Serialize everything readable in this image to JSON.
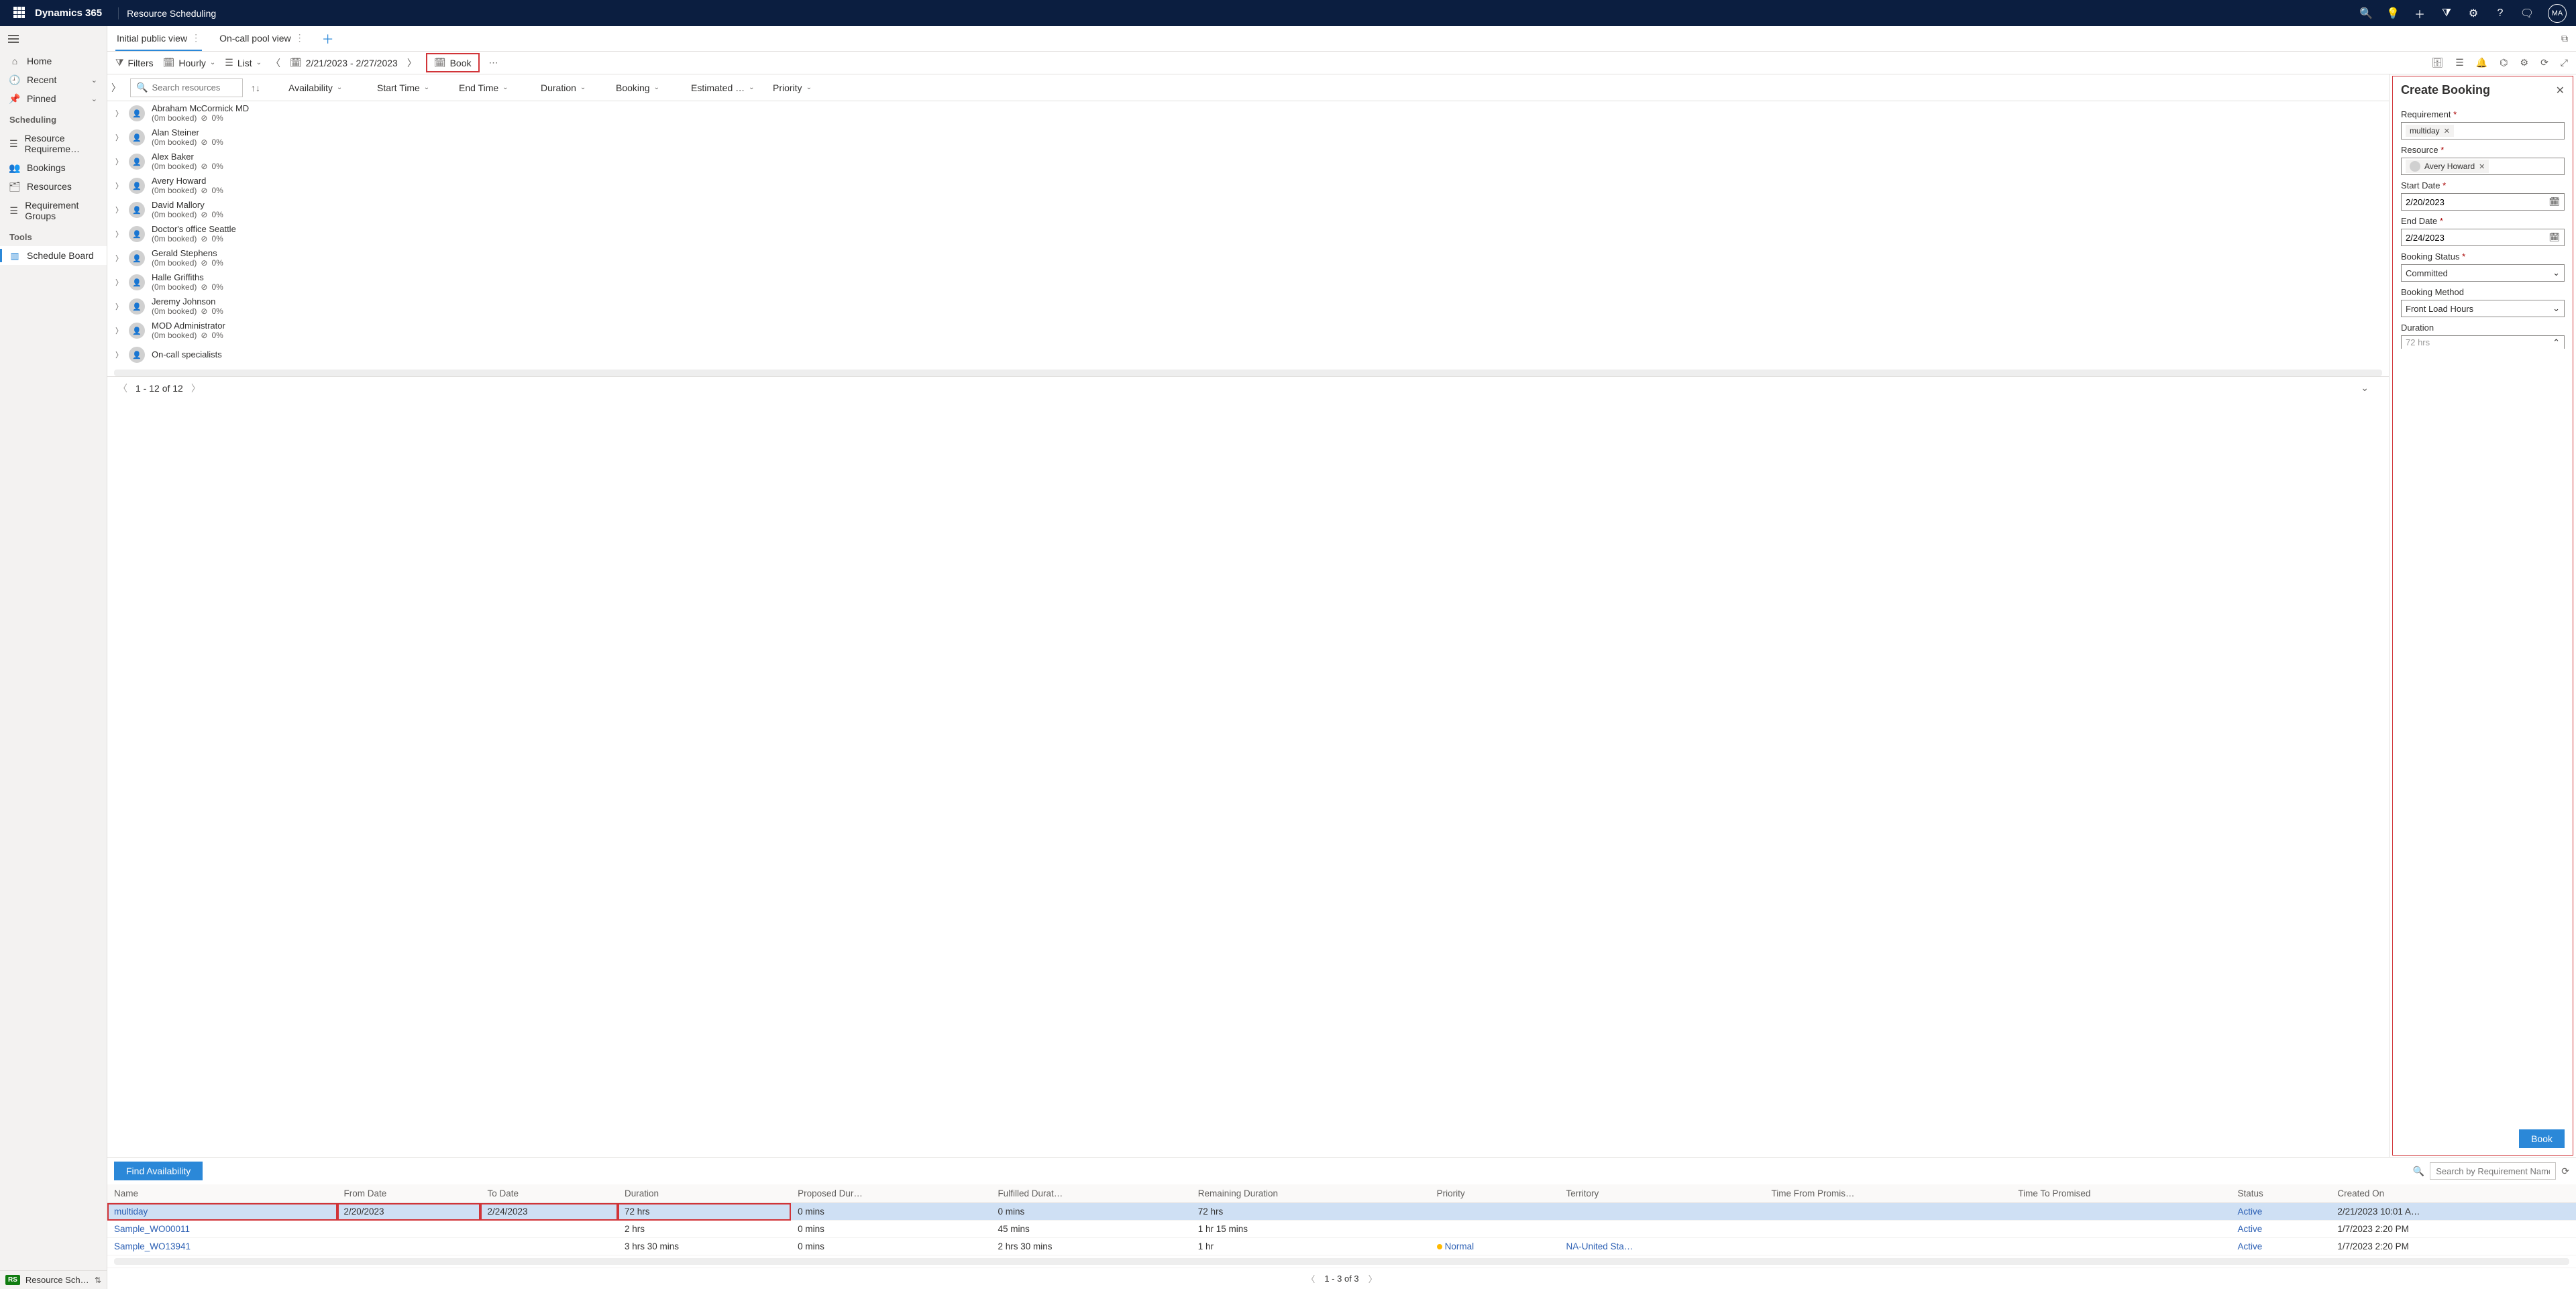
{
  "topbar": {
    "brand": "Dynamics 365",
    "area": "Resource Scheduling",
    "avatar": "MA"
  },
  "sidenav": {
    "home": "Home",
    "recent": "Recent",
    "pinned": "Pinned",
    "group_scheduling": "Scheduling",
    "resource_requirements": "Resource Requireme…",
    "bookings": "Bookings",
    "resources": "Resources",
    "requirement_groups": "Requirement Groups",
    "group_tools": "Tools",
    "schedule_board": "Schedule Board",
    "footer_badge": "RS",
    "footer_text": "Resource Schedul…"
  },
  "tabs": [
    {
      "label": "Initial public view",
      "active": true
    },
    {
      "label": "On-call pool view",
      "active": false
    }
  ],
  "toolbar": {
    "filters": "Filters",
    "hourly": "Hourly",
    "list": "List",
    "daterange": "2/21/2023 - 2/27/2023",
    "book": "Book"
  },
  "grid": {
    "search_placeholder": "Search resources",
    "columns": {
      "availability": "Availability",
      "start_time": "Start Time",
      "end_time": "End Time",
      "duration": "Duration",
      "booking": "Booking",
      "estimated": "Estimated …",
      "priority": "Priority"
    },
    "resources": [
      {
        "name": "Abraham McCormick MD",
        "sub": "(0m booked)",
        "pct": "0%"
      },
      {
        "name": "Alan Steiner",
        "sub": "(0m booked)",
        "pct": "0%"
      },
      {
        "name": "Alex Baker",
        "sub": "(0m booked)",
        "pct": "0%"
      },
      {
        "name": "Avery Howard",
        "sub": "(0m booked)",
        "pct": "0%"
      },
      {
        "name": "David Mallory",
        "sub": "(0m booked)",
        "pct": "0%"
      },
      {
        "name": "Doctor's office Seattle",
        "sub": "(0m booked)",
        "pct": "0%"
      },
      {
        "name": "Gerald Stephens",
        "sub": "(0m booked)",
        "pct": "0%"
      },
      {
        "name": "Halle Griffiths",
        "sub": "(0m booked)",
        "pct": "0%"
      },
      {
        "name": "Jeremy Johnson",
        "sub": "(0m booked)",
        "pct": "0%"
      },
      {
        "name": "MOD Administrator",
        "sub": "(0m booked)",
        "pct": "0%"
      },
      {
        "name": "On-call specialists",
        "sub": "",
        "pct": ""
      }
    ],
    "pager": "1 - 12 of 12"
  },
  "panel": {
    "title": "Create Booking",
    "requirement_label": "Requirement",
    "requirement_value": "multiday",
    "resource_label": "Resource",
    "resource_value": "Avery Howard",
    "start_date_label": "Start Date",
    "start_date_value": "2/20/2023",
    "end_date_label": "End Date",
    "end_date_value": "2/24/2023",
    "booking_status_label": "Booking Status",
    "booking_status_value": "Committed",
    "booking_method_label": "Booking Method",
    "booking_method_value": "Front Load Hours",
    "duration_label": "Duration",
    "duration_value": "72 hrs",
    "book_btn": "Book"
  },
  "bottom": {
    "find_availability": "Find Availability",
    "search_placeholder": "Search by Requirement Name",
    "columns": [
      "Name",
      "From Date",
      "To Date",
      "Duration",
      "Proposed Dur…",
      "Fulfilled Durat…",
      "Remaining Duration",
      "Priority",
      "Territory",
      "Time From Promis…",
      "Time To Promised",
      "Status",
      "Created On"
    ],
    "rows": [
      {
        "name": "multiday",
        "from": "2/20/2023",
        "to": "2/24/2023",
        "dur": "72 hrs",
        "proposed": "0 mins",
        "fulfilled": "0 mins",
        "remaining": "72 hrs",
        "priority": "",
        "territory": "",
        "tfp": "",
        "ttp": "",
        "status": "Active",
        "created": "2/21/2023 10:01 A…",
        "selected": true,
        "hl": true
      },
      {
        "name": "Sample_WO00011",
        "from": "",
        "to": "",
        "dur": "2 hrs",
        "proposed": "0 mins",
        "fulfilled": "45 mins",
        "remaining": "1 hr 15 mins",
        "priority": "",
        "territory": "",
        "tfp": "",
        "ttp": "",
        "status": "Active",
        "created": "1/7/2023 2:20 PM"
      },
      {
        "name": "Sample_WO13941",
        "from": "",
        "to": "",
        "dur": "3 hrs 30 mins",
        "proposed": "0 mins",
        "fulfilled": "2 hrs 30 mins",
        "remaining": "1 hr",
        "priority": "Normal",
        "priority_dot": true,
        "territory": "NA-United Sta…",
        "tfp": "",
        "ttp": "",
        "status": "Active",
        "created": "1/7/2023 2:20 PM"
      }
    ],
    "pager": "1 - 3 of 3"
  }
}
